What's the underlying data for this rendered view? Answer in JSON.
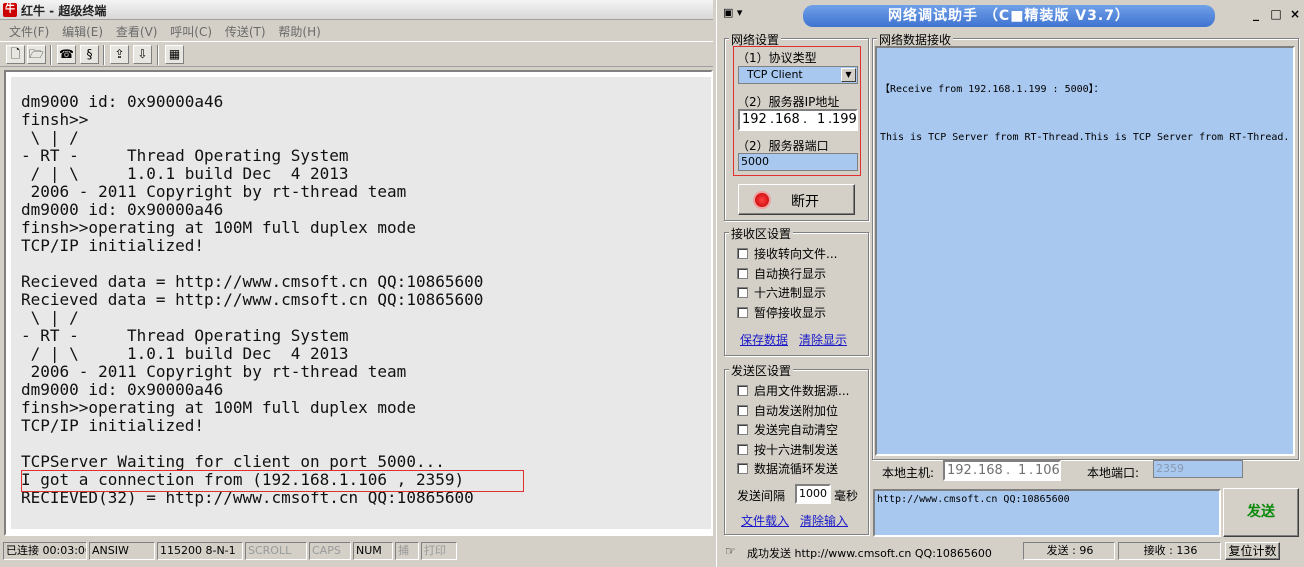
{
  "terminal": {
    "title": "红牛 - 超级终端",
    "app_icon": "ox-head-icon",
    "menu": [
      "文件(F)",
      "编辑(E)",
      "查看(V)",
      "呼叫(C)",
      "传送(T)",
      "帮助(H)"
    ],
    "toolbar_icons": [
      "new-icon",
      "open-icon",
      "phone-icon",
      "disconnect-icon",
      "send-icon",
      "receive-icon",
      "properties-icon"
    ],
    "lines": [
      "dm9000 id: 0x90000a46",
      "finsh>>",
      " \\ | /",
      "- RT -     Thread Operating System",
      " / | \\     1.0.1 build Dec  4 2013",
      " 2006 - 2011 Copyright by rt-thread team",
      "dm9000 id: 0x90000a46",
      "finsh>>operating at 100M full duplex mode",
      "TCP/IP initialized!",
      "",
      "Recieved data = http://www.cmsoft.cn QQ:10865600",
      "Recieved data = http://www.cmsoft.cn QQ:10865600",
      " \\ | /",
      "- RT -     Thread Operating System",
      " / | \\     1.0.1 build Dec  4 2013",
      " 2006 - 2011 Copyright by rt-thread team",
      "dm9000 id: 0x90000a46",
      "finsh>>operating at 100M full duplex mode",
      "TCP/IP initialized!",
      "",
      "TCPServer Waiting for client on port 5000...",
      "I got a connection from (192.168.1.106 , 2359)",
      "RECIEVED(32) = http://www.cmsoft.cn QQ:10865600",
      "",
      "_"
    ],
    "status": {
      "connected": "已连接 00:03:00",
      "emulation": "ANSIW",
      "port": "115200 8-N-1",
      "scroll": "SCROLL",
      "caps": "CAPS",
      "num": "NUM",
      "capture": "捕",
      "print": "打印"
    }
  },
  "netassist": {
    "title": "网络调试助手  （C■精装版 V3.7）",
    "sys_menu": "▣ ▾",
    "window_buttons": [
      "_",
      "□",
      "×"
    ],
    "settings": {
      "group_label": "网络设置",
      "protocol_label": "（1）协议类型",
      "protocol_value": "TCP Client",
      "ip_label": "（2）服务器IP地址",
      "ip_parts": [
        "192",
        "168",
        "1",
        "199"
      ],
      "port_label": "（2）服务器端口",
      "port_value": "5000",
      "disconnect_label": "断开"
    },
    "recv_settings": {
      "group_label": "接收区设置",
      "options": [
        "接收转向文件...",
        "自动换行显示",
        "十六进制显示",
        "暂停接收显示"
      ],
      "save_link": "保存数据",
      "clear_link": "清除显示"
    },
    "send_settings": {
      "group_label": "发送区设置",
      "options": [
        "启用文件数据源...",
        "自动发送附加位",
        "发送完自动清空",
        "按十六进制发送",
        "数据流循环发送"
      ],
      "interval_label": "发送间隔",
      "interval_value": "1000",
      "interval_unit": "毫秒",
      "load_link": "文件载入",
      "clear_link": "清除输入"
    },
    "receive": {
      "group_label": "网络数据接收",
      "lines": [
        "【Receive from 192.168.1.199 : 5000】：",
        "This is TCP Server from RT-Thread.This is TCP Server from RT-Thread."
      ]
    },
    "local": {
      "host_label": "本地主机:",
      "host_parts": [
        "192",
        "168",
        "1",
        "106"
      ],
      "port_label": "本地端口:",
      "port_value": "2359"
    },
    "send": {
      "text": "http://www.cmsoft.cn QQ:10865600",
      "button": "发送"
    },
    "status": {
      "message": "成功发送 http://www.cmsoft.cn QQ:10865600",
      "sent": "发送 : 96",
      "received": "接收 : 136",
      "reset": "复位计数"
    }
  }
}
